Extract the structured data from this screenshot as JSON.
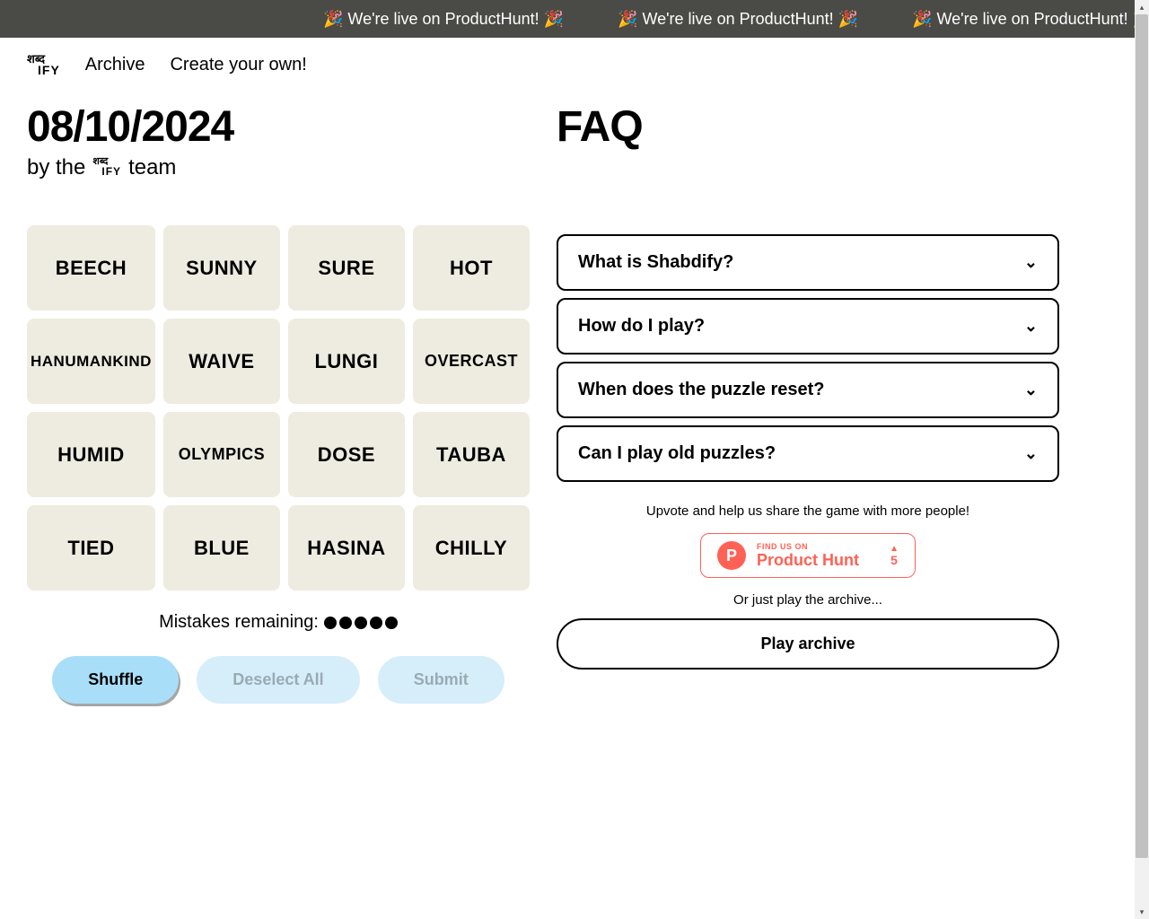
{
  "announcement": {
    "text": "🎉 We're live on ProductHunt! 🎉"
  },
  "nav": {
    "archive": "Archive",
    "create": "Create your own!"
  },
  "logo": {
    "top": "शब्द",
    "bottom": "IFY"
  },
  "date": "08/10/2024",
  "byline_prefix": "by the",
  "byline_suffix": "team",
  "tiles": [
    "BEECH",
    "SUNNY",
    "SURE",
    "HOT",
    "HANUMANKIND",
    "WAIVE",
    "LUNGI",
    "OVERCAST",
    "HUMID",
    "OLYMPICS",
    "DOSE",
    "TAUBA",
    "TIED",
    "BLUE",
    "HASINA",
    "CHILLY"
  ],
  "mistakes": {
    "label": "Mistakes remaining:",
    "remaining": 5
  },
  "controls": {
    "shuffle": "Shuffle",
    "deselect": "Deselect All",
    "submit": "Submit"
  },
  "faq": {
    "title": "FAQ",
    "items": [
      "What is Shabdify?",
      "How do I play?",
      "When does the puzzle reset?",
      "Can I play old puzzles?"
    ]
  },
  "upvote_text": "Upvote and help us share the game with more people!",
  "ph": {
    "find": "FIND US ON",
    "name": "Product Hunt",
    "votes": "5"
  },
  "or_text": "Or just play the archive...",
  "play_archive": "Play archive"
}
